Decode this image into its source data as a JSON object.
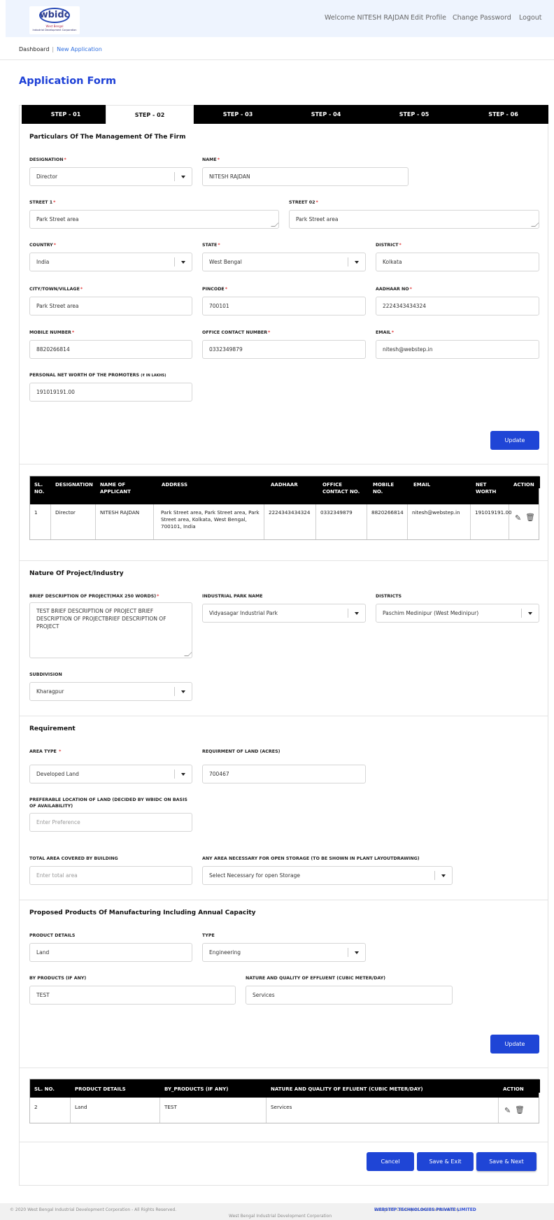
{
  "header": {
    "logo_text": "wbidc",
    "logo_sub1": "West Bengal",
    "logo_sub2": "Industrial Development Corporation",
    "welcome": "Welcome NITESH RAJDAN",
    "edit_profile": "Edit Profile",
    "change_password": "Change Password",
    "logout": "Logout"
  },
  "breadcrumb": {
    "home": "Dashboard",
    "sep": "|",
    "current": "New Application"
  },
  "page_title": "Application Form",
  "steps": [
    "STEP - 01",
    "STEP - 02",
    "STEP - 03",
    "STEP - 04",
    "STEP - 05",
    "STEP - 06"
  ],
  "active_step": "STEP - 02",
  "management": {
    "title": "Particulars Of The Management Of The Firm",
    "designation_label": "DESIGNATION",
    "designation_value": "Director",
    "name_label": "NAME",
    "name_value": "NITESH RAJDAN",
    "street1_label": "STREET 1",
    "street1_value": "Park Street area",
    "street2_label": "STREET 02",
    "street2_value": "Park Street area",
    "country_label": "COUNTRY",
    "country_value": "India",
    "state_label": "STATE",
    "state_value": "West Bengal",
    "district_label": "DISTRICT",
    "district_value": "Kolkata",
    "city_label": "CITY/TOWN/VILLAGE",
    "city_value": "Park Street area",
    "pincode_label": "PINCODE",
    "pincode_value": "700101",
    "aadhaar_label": "AADHAAR NO",
    "aadhaar_value": "2224343434324",
    "mobile_label": "MOBILE NUMBER",
    "mobile_value": "8820266814",
    "office_label": "OFFICE CONTACT NUMBER",
    "office_value": "0332349879",
    "email_label": "EMAIL",
    "email_value": "nitesh@webstep.in",
    "networth_label": "PERSONAL NET WORTH OF THE PROMOTERS",
    "networth_unit": "(₹ IN LAKHS)",
    "networth_value": "191019191.00",
    "update_label": "Update"
  },
  "management_table": {
    "headers": [
      "SL. NO.",
      "DESIGNATION",
      "NAME OF APPLICANT",
      "ADDRESS",
      "AADHAAR",
      "OFFICE CONTACT NO.",
      "MOBILE NO.",
      "EMAIL",
      "NET WORTH",
      "ACTION"
    ],
    "rows": [
      [
        "1",
        "Director",
        "NITESH RAJDAN",
        "Park Street area, Park Street area, Park Street area, Kolkata, West Bengal, 700101, India",
        "2224343434324",
        "0332349879",
        "8820266814",
        "nitesh@webstep.in",
        "191019191.00"
      ]
    ]
  },
  "project": {
    "title": "Nature Of Project/Industry",
    "brief_label": "BRIEF DESCRIPTION OF PROJECT(MAX 250 WORDS)",
    "brief_value": "TEST BRIEF DESCRIPTION OF PROJECT BRIEF DESCRIPTION OF PROJECTBRIEF DESCRIPTION OF PROJECT",
    "park_label": "INDUSTRIAL PARK NAME",
    "park_value": "Vidyasagar Industrial Park",
    "districts_label": "DISTRICTS",
    "districts_value": "Paschim Medinipur (West Medinipur)",
    "subdivision_label": "SUBDIVISION",
    "subdivision_value": "Kharagpur"
  },
  "requirement": {
    "title": "Requirement",
    "area_type_label": "AREA TYPE",
    "area_type_value": "Developed Land",
    "land_label": "REQUIRMENT OF LAND (ACRES)",
    "land_value": "700467",
    "location_label": "PREFERABLE LOCATION OF LAND (DECIDED BY WBIDC ON BASIS OF AVAILABILITY)",
    "location_placeholder": "Enter Preference",
    "total_area_label": "TOTAL AREA COVERED BY BUILDING",
    "total_area_placeholder": "Enter total area",
    "open_storage_label": "ANY AREA NECESSARY FOR OPEN STORAGE (TO BE SHOWN IN PLANT LAYOUTDRAWING)",
    "open_storage_value": "Select Necessary for open Storage"
  },
  "products": {
    "title": "Proposed Products Of Manufacturing Including Annual Capacity",
    "details_label": "PRODUCT DETAILS",
    "details_value": "Land",
    "type_label": "TYPE",
    "type_value": "Engineering",
    "by_label": "BY PRODUCTS (IF ANY)",
    "by_value": "TEST",
    "effluent_label": "NATURE AND QUALITY OF EFFLUENT (CUBIC METER/DAY)",
    "effluent_value": "Services",
    "update_label": "Update"
  },
  "products_table": {
    "headers": [
      "SL. NO.",
      "PRODUCT DETAILS",
      "BY_PRODUCTS (IF ANY)",
      "NATURE AND QUALITY OF EFLUENT (CUBIC METER/DAY)",
      "ACTION"
    ],
    "rows": [
      [
        "2",
        "Land",
        "TEST",
        "Services"
      ]
    ]
  },
  "actions": {
    "cancel": "Cancel",
    "save_exit": "Save & Exit",
    "save_next": "Save & Next"
  },
  "footer": {
    "copyright": "© 2020 West Bengal Industrial Development Corporation - All Rights Reserved.",
    "center": "West Bengal Industrial Development Corporation",
    "designed": "Designed, Developed and Maintained by",
    "company": "WEBSTEP TECHNOLOGIES PRIVATE LIMITED"
  },
  "colors": {
    "accent": "#1f45d6",
    "title": "#1c3fd6",
    "header_bg": "#eef4fe",
    "required": "#e23b3b"
  }
}
